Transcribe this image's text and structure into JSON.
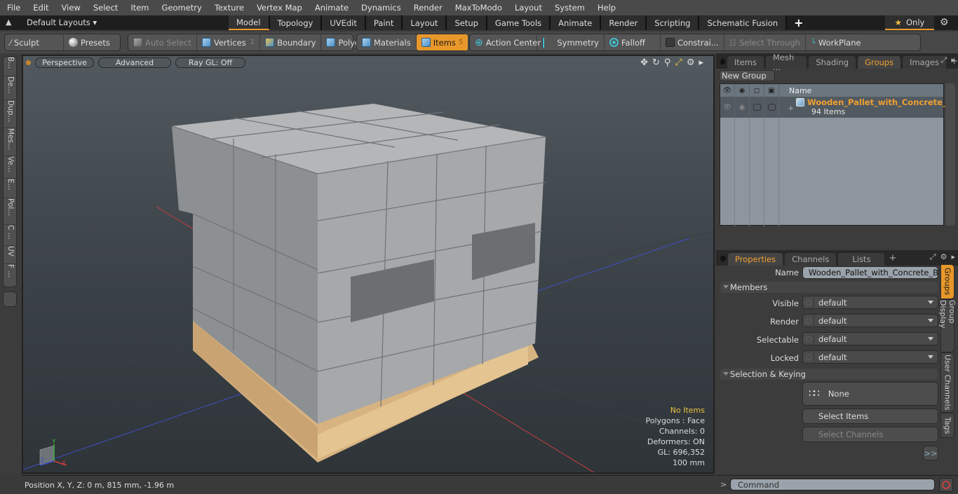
{
  "menu": [
    "File",
    "Edit",
    "View",
    "Select",
    "Item",
    "Geometry",
    "Texture",
    "Vertex Map",
    "Animate",
    "Dynamics",
    "Render",
    "MaxToModo",
    "Layout",
    "System",
    "Help"
  ],
  "layout_bar": {
    "layouts_label": "Default Layouts",
    "tabs": [
      "Model",
      "Topology",
      "UVEdit",
      "Paint",
      "Layout",
      "Setup",
      "Game Tools",
      "Animate",
      "Render",
      "Scripting",
      "Schematic Fusion"
    ],
    "active_tab": "Model",
    "only_label": "Only"
  },
  "toolbar": {
    "sculpt": "Sculpt",
    "presets": "Presets",
    "auto_select": "Auto Select",
    "vertices": "Vertices",
    "vertices_count": "1",
    "boundary": "Boundary",
    "polygons": "Polygons",
    "materials": "Materials",
    "items": "Items",
    "items_count": "5",
    "action_center": "Action Center",
    "symmetry": "Symmetry",
    "falloff": "Falloff",
    "constraints": "Constrai...",
    "select_through": "Select Through",
    "workplane": "WorkPlane"
  },
  "left_strip": [
    "B...",
    "De...",
    "Dup...",
    "Mes...",
    "Ve...",
    "E...",
    "Pol...",
    "C ...",
    "UV",
    "F ..."
  ],
  "viewport": {
    "view_mode": "Perspective",
    "shading": "Advanced",
    "raygl": "Ray GL: Off",
    "stats": {
      "selection": "No Items",
      "polygons": "Polygons : Face",
      "channels": "Channels: 0",
      "deformers": "Deformers: ON",
      "gl": "GL: 696,352",
      "grid": "100 mm"
    },
    "axis_labels": {
      "x": "X",
      "y": "Y",
      "z": "Z"
    },
    "colors": {
      "x_axis": "#c84040",
      "y_axis": "#40b040",
      "z_axis": "#4050c8",
      "concrete": "#a6a8aa",
      "wood": "#e2c08e"
    }
  },
  "status": {
    "position": "Position X, Y, Z:   0 m, 815 mm, -1.96 m"
  },
  "groups_panel": {
    "tabs": [
      "Items",
      "Mesh ...",
      "Shading",
      "Groups",
      "Images"
    ],
    "active_tab": "Groups",
    "new_group": "New Group",
    "column_name": "Name",
    "group_name": "Wooden_Pallet_with_Concrete_...",
    "group_count": "94 Items"
  },
  "properties_panel": {
    "tabs": [
      "Properties",
      "Channels",
      "Lists"
    ],
    "active_tab": "Properties",
    "name_label": "Name",
    "name_value": "Wooden_Pallet_with_Concrete_Blocks",
    "members_section": "Members",
    "members": [
      {
        "label": "Visible",
        "value": "default"
      },
      {
        "label": "Render",
        "value": "default"
      },
      {
        "label": "Selectable",
        "value": "default"
      },
      {
        "label": "Locked",
        "value": "default"
      }
    ],
    "selection_section": "Selection & Keying",
    "none_label": "None",
    "select_items": "Select Items",
    "select_channels": "Select Channels",
    "more": ">>",
    "side_tabs": [
      "Groups",
      "Group Display",
      "User Channels",
      "Tags"
    ],
    "active_side_tab": "Groups"
  },
  "command": {
    "placeholder": "Command",
    "prompt": ">"
  },
  "accent_color": "#e8982a"
}
